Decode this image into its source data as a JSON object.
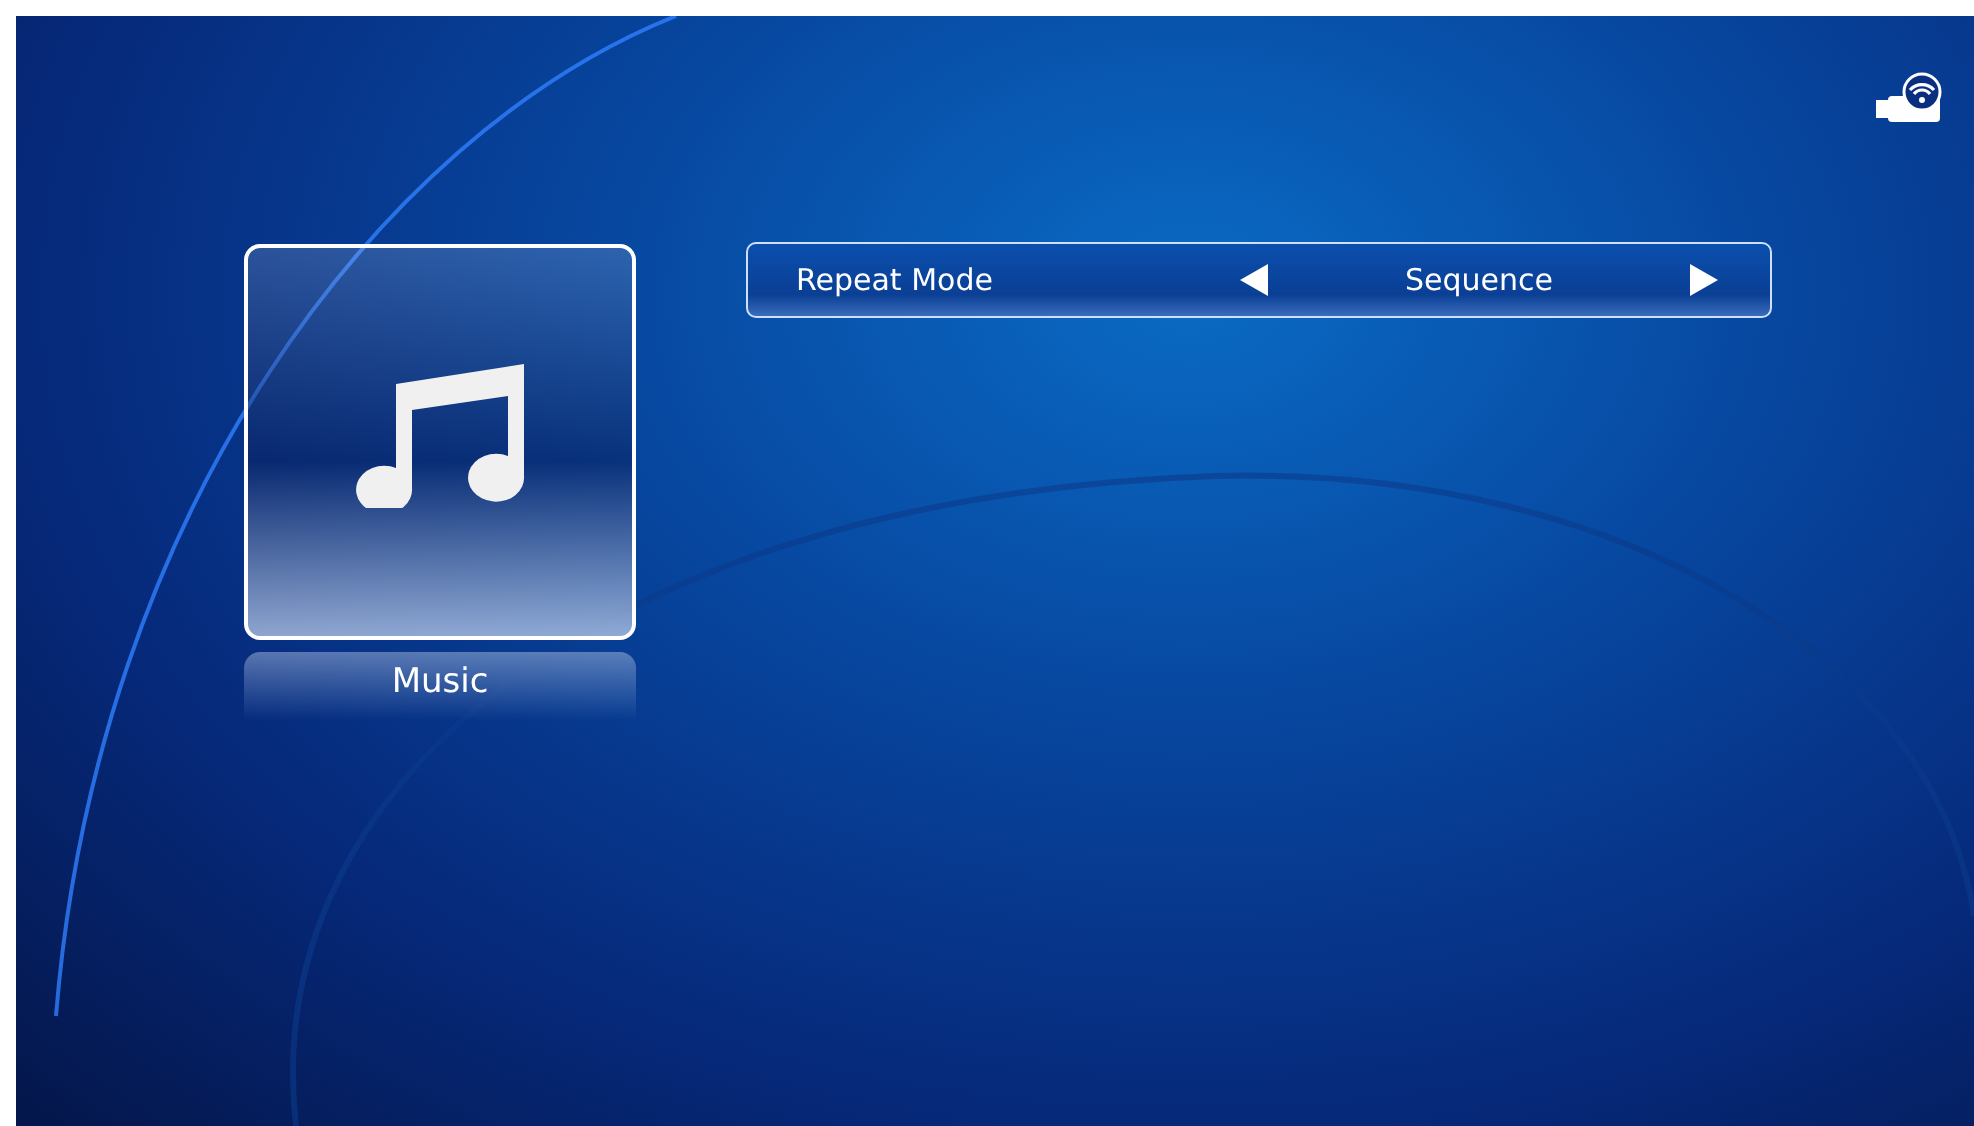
{
  "tile": {
    "label": "Music",
    "selected": true
  },
  "settings": [
    {
      "label": "Repeat Mode",
      "value": "Sequence"
    }
  ]
}
